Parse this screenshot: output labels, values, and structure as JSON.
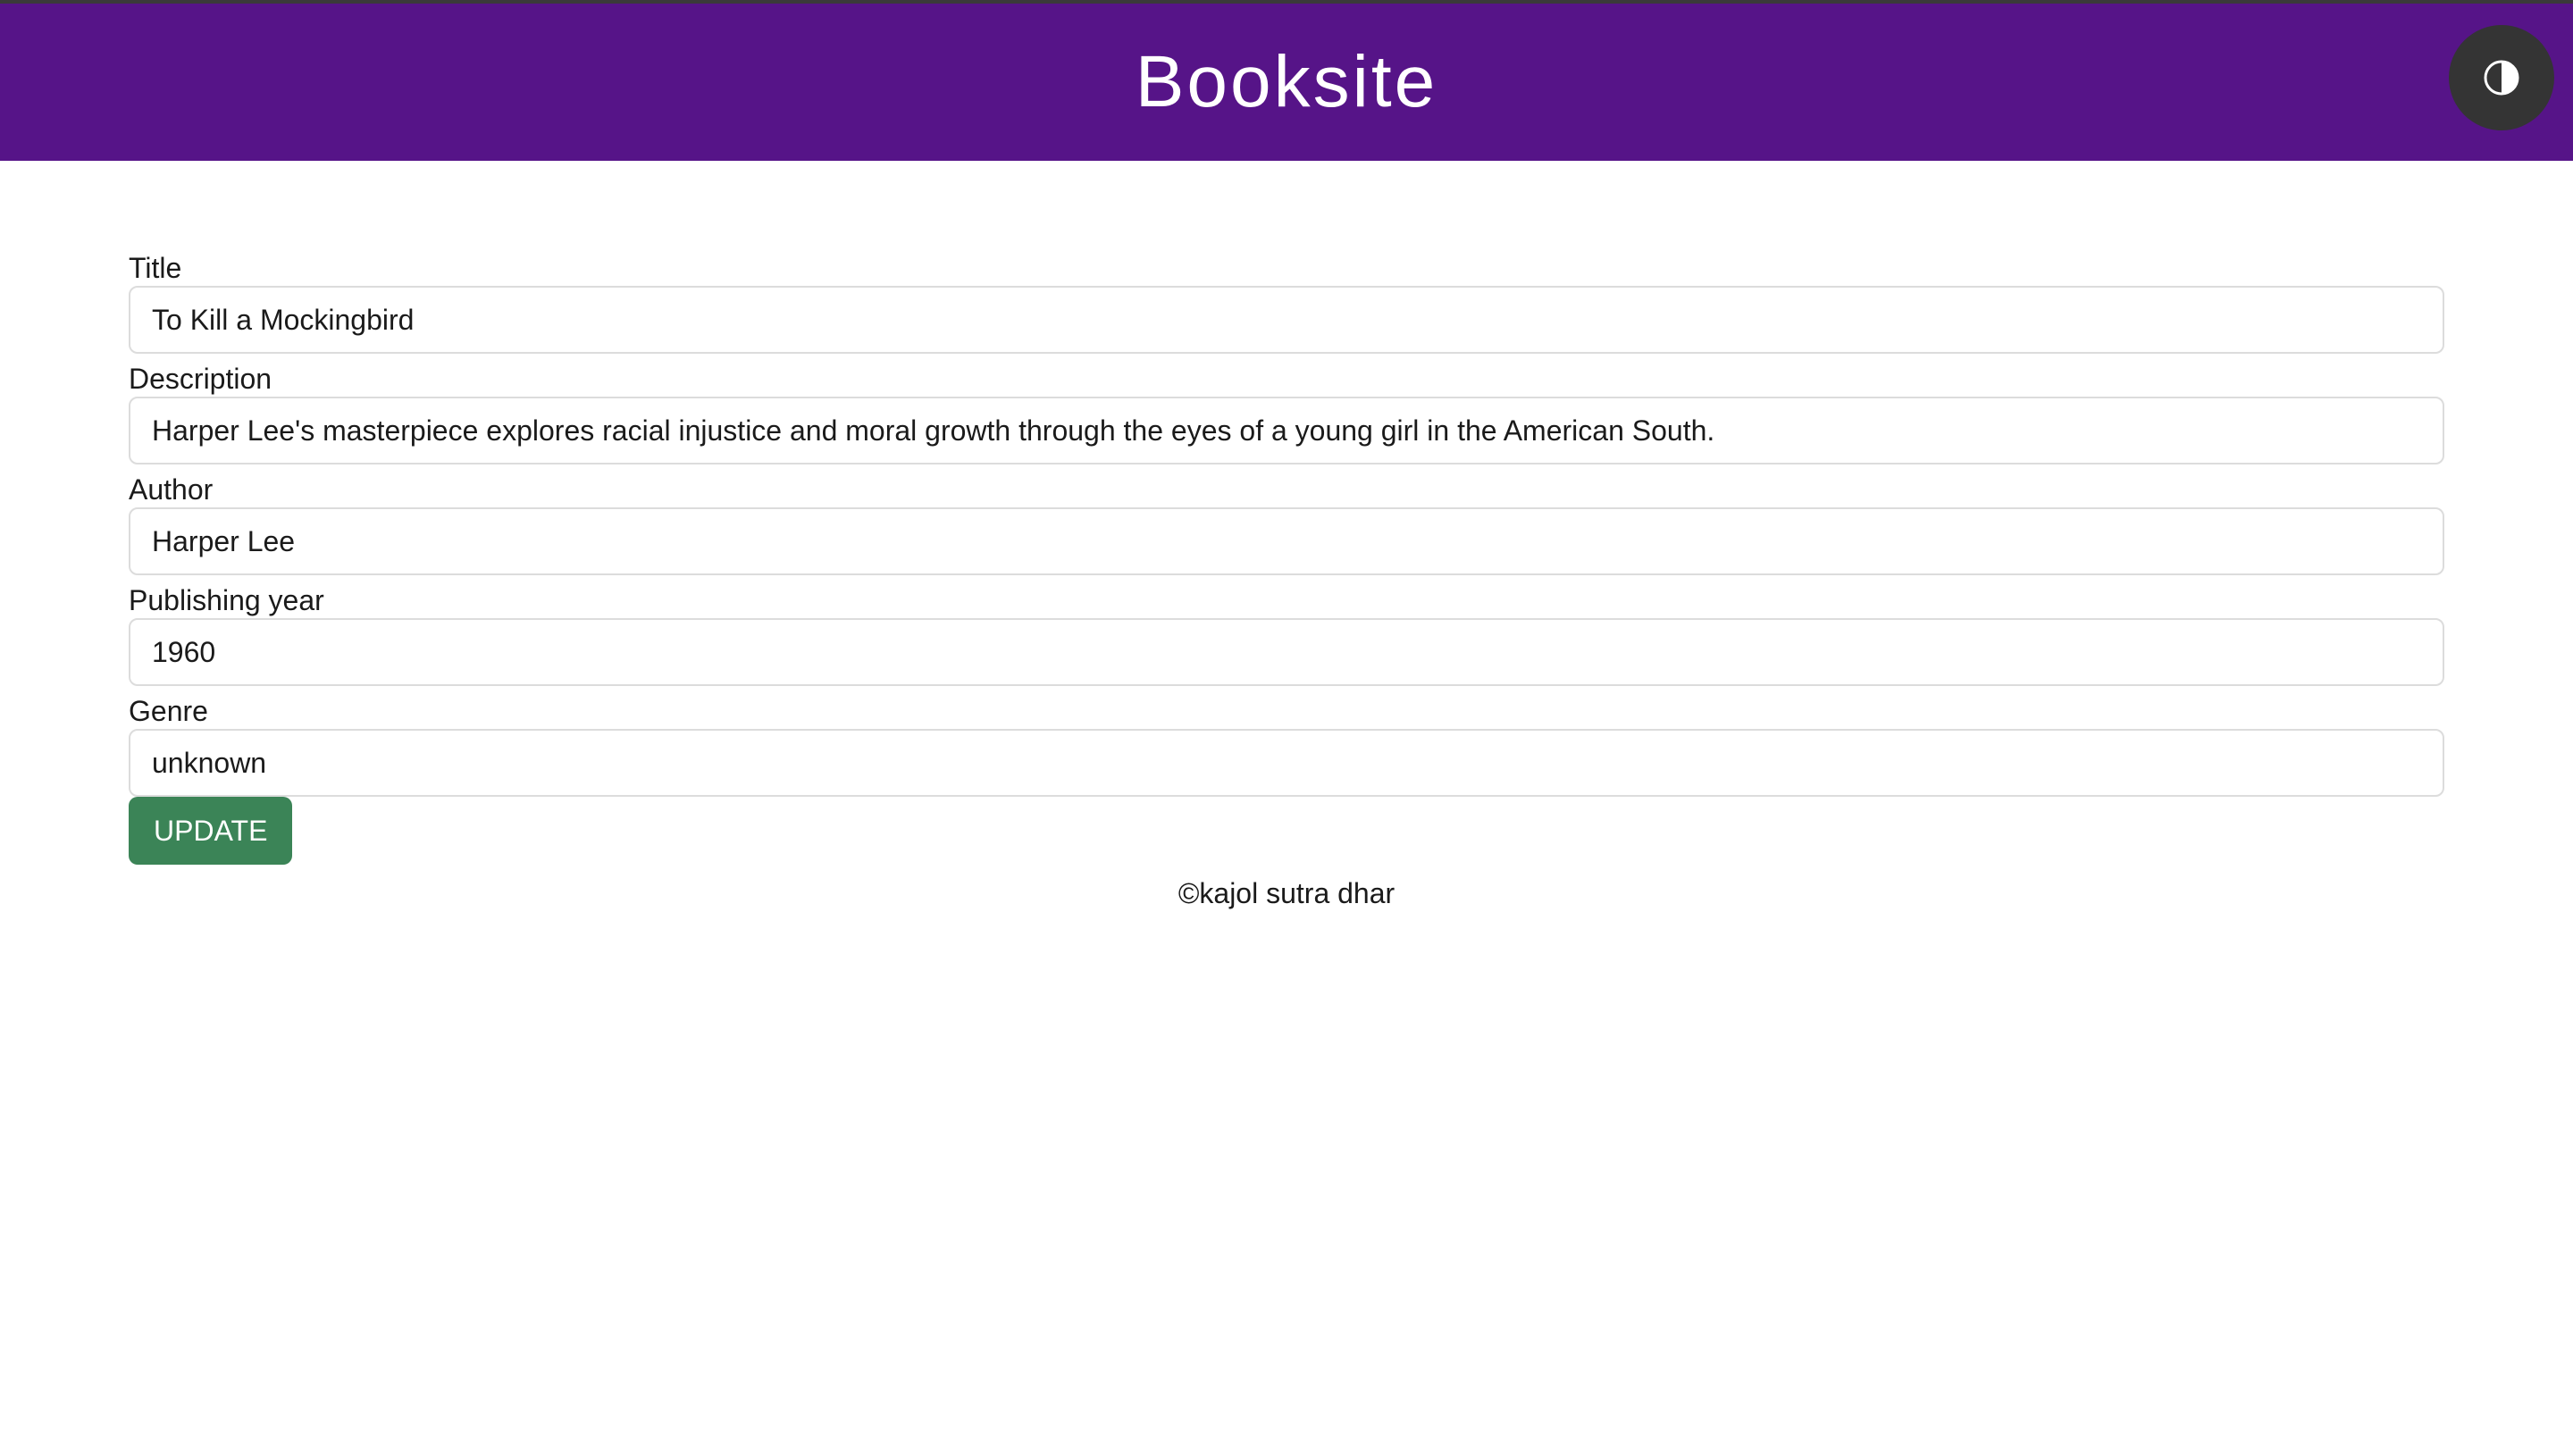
{
  "header": {
    "title": "Booksite",
    "background_color": "#561488",
    "theme_toggle_icon": "contrast-icon"
  },
  "form": {
    "fields": [
      {
        "label": "Title",
        "value": "To Kill a Mockingbird"
      },
      {
        "label": "Description",
        "value": "Harper Lee's masterpiece explores racial injustice and moral growth through the eyes of a young girl in the American South."
      },
      {
        "label": "Author",
        "value": "Harper Lee"
      },
      {
        "label": "Publishing year",
        "value": "1960"
      },
      {
        "label": "Genre",
        "value": "unknown"
      }
    ],
    "submit_label": "UPDATE",
    "submit_color": "#3b8457"
  },
  "footer": {
    "text": "©kajol sutra dhar"
  }
}
